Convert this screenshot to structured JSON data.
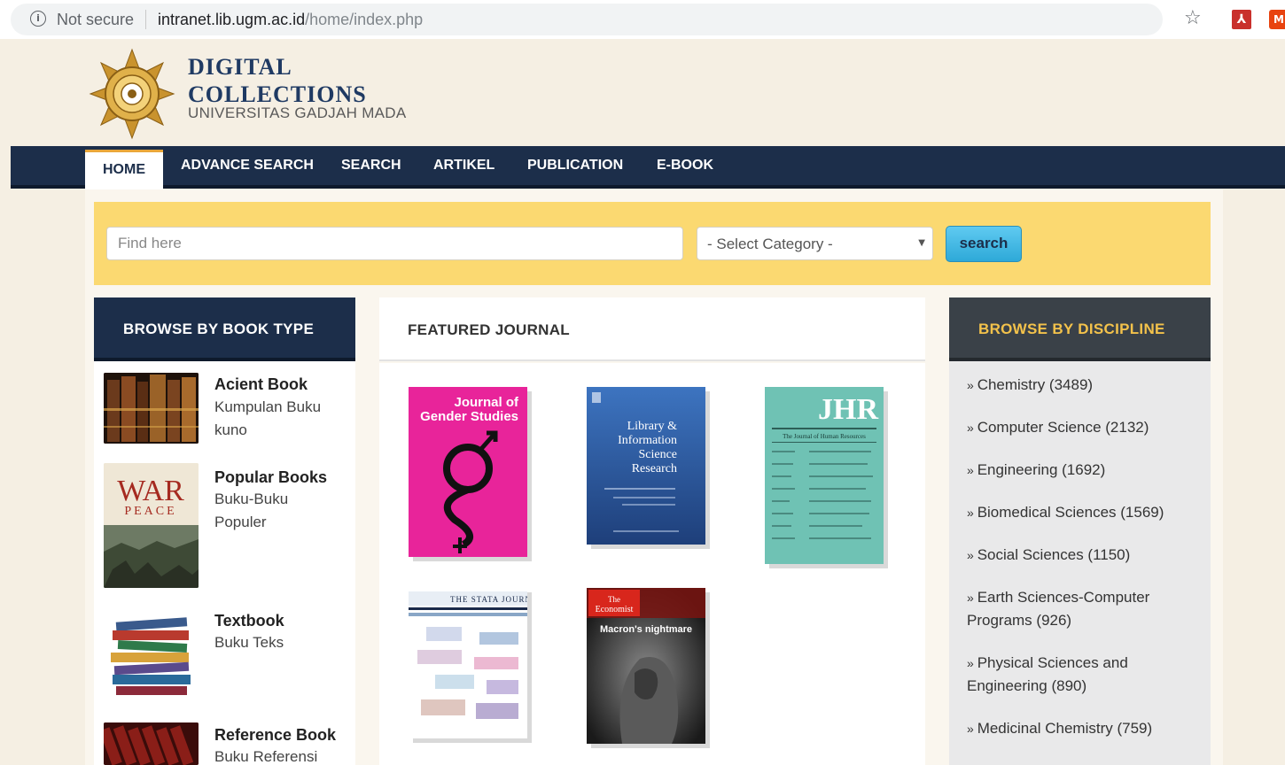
{
  "browser": {
    "security_label": "Not secure",
    "url_host": "intranet.lib.ugm.ac.id",
    "url_path": "/home/index.php"
  },
  "site": {
    "title_line1": "DIGITAL",
    "title_line2": "COLLECTIONS",
    "subtitle": "UNIVERSITAS GADJAH MADA"
  },
  "nav": {
    "items": [
      "HOME",
      "ADVANCE SEARCH",
      "SEARCH",
      "ARTIKEL",
      "PUBLICATION",
      "E-BOOK"
    ],
    "active": "HOME"
  },
  "search": {
    "placeholder": "Find here",
    "category_selected": "- Select Category -",
    "button_label": "search"
  },
  "book_types": {
    "heading": "BROWSE BY BOOK TYPE",
    "items": [
      {
        "title": "Acient Book",
        "desc": "Kumpulan Buku kuno"
      },
      {
        "title": "Popular Books",
        "desc": "Buku-Buku Populer"
      },
      {
        "title": "Textbook",
        "desc": "Buku Teks"
      },
      {
        "title": "Reference Book",
        "desc": "Buku Referensi"
      }
    ]
  },
  "featured": {
    "heading": "FEATURED JOURNAL",
    "covers": [
      {
        "title": "Journal of Gender Studies",
        "color": "#e8249a"
      },
      {
        "title": "Library & Information Science Research",
        "color": "#2f5fa8"
      },
      {
        "title": "JHR",
        "subtitle": "The Journal of Human Resources",
        "color": "#6fc2b4"
      },
      {
        "title": "THE STATA JOURNAL",
        "color": "#ffffff"
      },
      {
        "title": "The Economist",
        "headline": "Macron's nightmare",
        "color": "#d8261c"
      }
    ]
  },
  "disciplines": {
    "heading": "BROWSE BY DISCIPLINE",
    "items": [
      "Chemistry (3489)",
      "Computer Science (2132)",
      "Engineering (1692)",
      "Biomedical Sciences (1569)",
      "Social Sciences (1150)",
      "Earth Sciences-Computer Programs (926)",
      "Physical Sciences and Engineering (890)",
      "Medicinal Chemistry (759)"
    ]
  },
  "colors": {
    "nav_bg": "#1c2e4a",
    "search_panel": "#fbd971",
    "discipline_heading": "#f3c24b",
    "search_button": "#2ea9d8"
  }
}
